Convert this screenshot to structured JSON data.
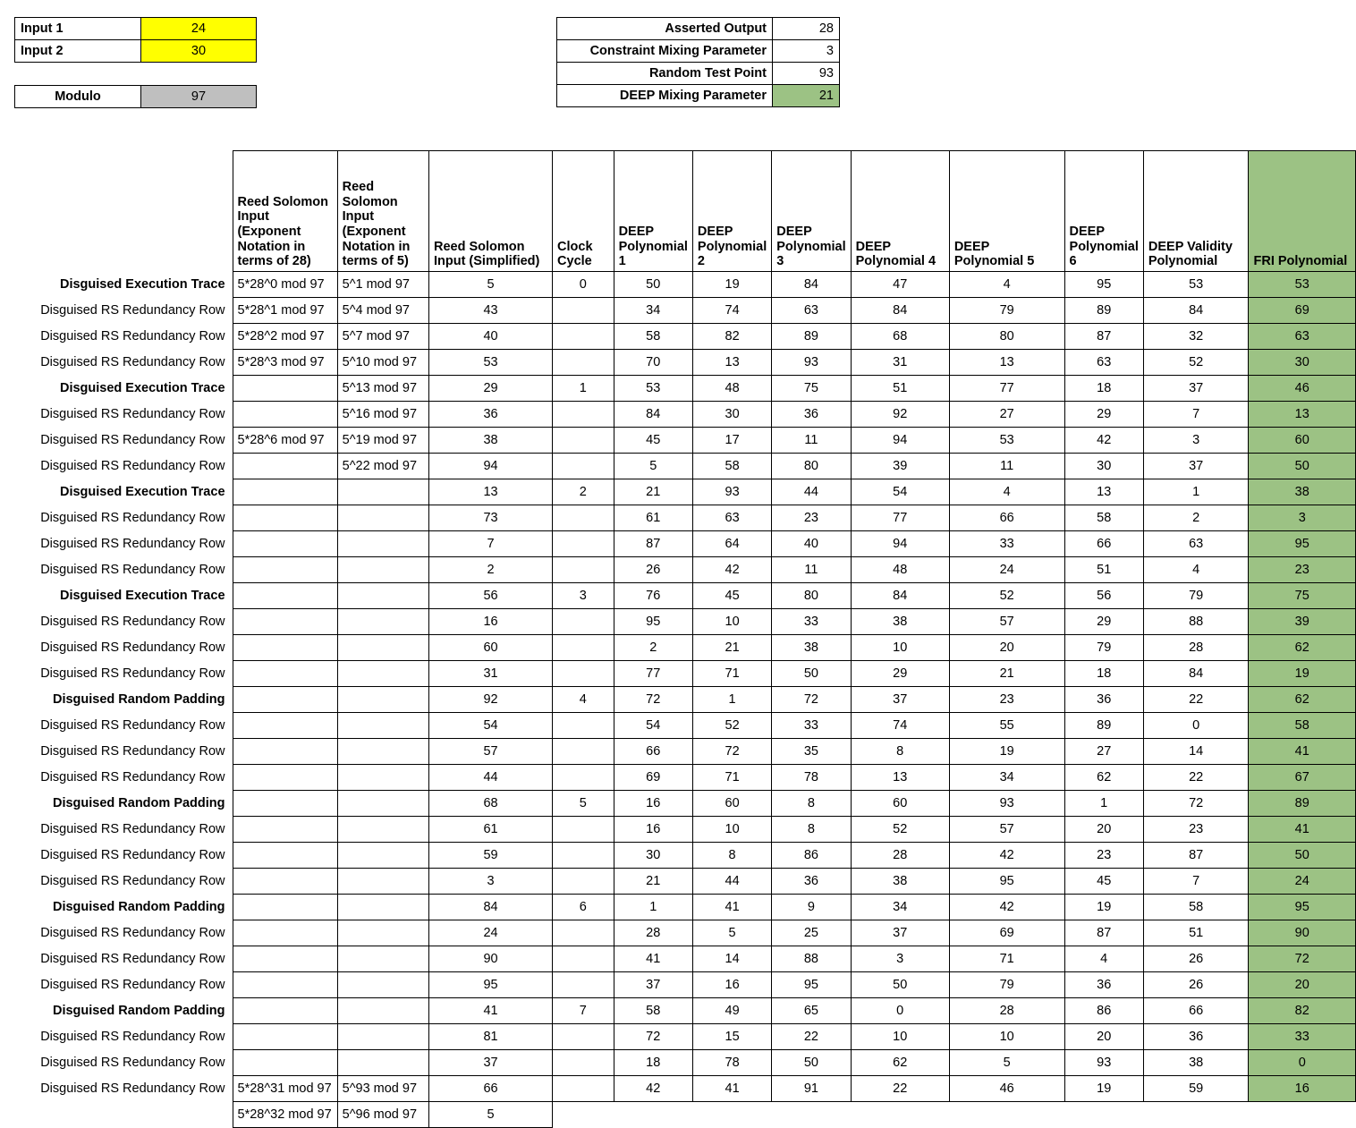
{
  "inputs_panel": {
    "rows": [
      {
        "label": "Input 1",
        "value": "24"
      },
      {
        "label": "Input 2",
        "value": "30"
      }
    ]
  },
  "modulo_panel": {
    "label": "Modulo",
    "value": "97"
  },
  "parameters_panel": {
    "rows": [
      {
        "label": "Asserted Output",
        "value": "28",
        "highlight": "none"
      },
      {
        "label": "Constraint Mixing Parameter",
        "value": "3",
        "highlight": "none"
      },
      {
        "label": "Random Test Point",
        "value": "93",
        "highlight": "none"
      },
      {
        "label": "DEEP Mixing Parameter",
        "value": "21",
        "highlight": "green"
      }
    ]
  },
  "colors": {
    "yellow_fill": "#ffff00",
    "gray_fill": "#bfbfbf",
    "green_fill": "#9cc284",
    "border": "#000000"
  },
  "main_table": {
    "headers": [
      "",
      "Reed Solomon Input (Exponent Notation in terms of 28)",
      "Reed Solomon Input (Exponent Notation in terms of 5)",
      "Reed Solomon Input (Simplified)",
      "Clock Cycle",
      "DEEP Polynomial 1",
      "DEEP Polynomial 2",
      "DEEP Polynomial 3",
      "DEEP Polynomial 4",
      "DEEP Polynomial 5",
      "DEEP Polynomial 6",
      "DEEP Validity Polynomial",
      "FRI Polynomial"
    ],
    "rows": [
      {
        "label": "Disguised Execution Trace",
        "bold": true,
        "rs28": "5*28^0 mod 97",
        "rs5": "5^1 mod 97",
        "simplified": "5",
        "clock": "0",
        "dp1": "50",
        "dp2": "19",
        "dp3": "84",
        "dp4": "47",
        "dp5": "4",
        "dp6": "95",
        "dvp": "53",
        "fri": "53"
      },
      {
        "label": "Disguised RS Redundancy Row",
        "bold": false,
        "rs28": "5*28^1 mod 97",
        "rs5": "5^4 mod 97",
        "simplified": "43",
        "clock": "",
        "dp1": "34",
        "dp2": "74",
        "dp3": "63",
        "dp4": "84",
        "dp5": "79",
        "dp6": "89",
        "dvp": "84",
        "fri": "69"
      },
      {
        "label": "Disguised RS Redundancy Row",
        "bold": false,
        "rs28": "5*28^2 mod 97",
        "rs5": "5^7 mod 97",
        "simplified": "40",
        "clock": "",
        "dp1": "58",
        "dp2": "82",
        "dp3": "89",
        "dp4": "68",
        "dp5": "80",
        "dp6": "87",
        "dvp": "32",
        "fri": "63"
      },
      {
        "label": "Disguised RS Redundancy Row",
        "bold": false,
        "rs28": "5*28^3 mod 97",
        "rs5": "5^10 mod 97",
        "simplified": "53",
        "clock": "",
        "dp1": "70",
        "dp2": "13",
        "dp3": "93",
        "dp4": "31",
        "dp5": "13",
        "dp6": "63",
        "dvp": "52",
        "fri": "30"
      },
      {
        "label": "Disguised Execution Trace",
        "bold": true,
        "rs28": "",
        "rs5": "5^13 mod 97",
        "simplified": "29",
        "clock": "1",
        "dp1": "53",
        "dp2": "48",
        "dp3": "75",
        "dp4": "51",
        "dp5": "77",
        "dp6": "18",
        "dvp": "37",
        "fri": "46"
      },
      {
        "label": "Disguised RS Redundancy Row",
        "bold": false,
        "rs28": "",
        "rs5": "5^16 mod 97",
        "simplified": "36",
        "clock": "",
        "dp1": "84",
        "dp2": "30",
        "dp3": "36",
        "dp4": "92",
        "dp5": "27",
        "dp6": "29",
        "dvp": "7",
        "fri": "13"
      },
      {
        "label": "Disguised RS Redundancy Row",
        "bold": false,
        "rs28": "5*28^6 mod 97",
        "rs5": "5^19 mod 97",
        "simplified": "38",
        "clock": "",
        "dp1": "45",
        "dp2": "17",
        "dp3": "11",
        "dp4": "94",
        "dp5": "53",
        "dp6": "42",
        "dvp": "3",
        "fri": "60"
      },
      {
        "label": "Disguised RS Redundancy Row",
        "bold": false,
        "rs28": "",
        "rs5": "5^22 mod 97",
        "simplified": "94",
        "clock": "",
        "dp1": "5",
        "dp2": "58",
        "dp3": "80",
        "dp4": "39",
        "dp5": "11",
        "dp6": "30",
        "dvp": "37",
        "fri": "50"
      },
      {
        "label": "Disguised Execution Trace",
        "bold": true,
        "rs28": "",
        "rs5": "",
        "simplified": "13",
        "clock": "2",
        "dp1": "21",
        "dp2": "93",
        "dp3": "44",
        "dp4": "54",
        "dp5": "4",
        "dp6": "13",
        "dvp": "1",
        "fri": "38"
      },
      {
        "label": "Disguised RS Redundancy Row",
        "bold": false,
        "rs28": "",
        "rs5": "",
        "simplified": "73",
        "clock": "",
        "dp1": "61",
        "dp2": "63",
        "dp3": "23",
        "dp4": "77",
        "dp5": "66",
        "dp6": "58",
        "dvp": "2",
        "fri": "3"
      },
      {
        "label": "Disguised RS Redundancy Row",
        "bold": false,
        "rs28": "",
        "rs5": "",
        "simplified": "7",
        "clock": "",
        "dp1": "87",
        "dp2": "64",
        "dp3": "40",
        "dp4": "94",
        "dp5": "33",
        "dp6": "66",
        "dvp": "63",
        "fri": "95"
      },
      {
        "label": "Disguised RS Redundancy Row",
        "bold": false,
        "rs28": "",
        "rs5": "",
        "simplified": "2",
        "clock": "",
        "dp1": "26",
        "dp2": "42",
        "dp3": "11",
        "dp4": "48",
        "dp5": "24",
        "dp6": "51",
        "dvp": "4",
        "fri": "23"
      },
      {
        "label": "Disguised Execution Trace",
        "bold": true,
        "rs28": "",
        "rs5": "",
        "simplified": "56",
        "clock": "3",
        "dp1": "76",
        "dp2": "45",
        "dp3": "80",
        "dp4": "84",
        "dp5": "52",
        "dp6": "56",
        "dvp": "79",
        "fri": "75"
      },
      {
        "label": "Disguised RS Redundancy Row",
        "bold": false,
        "rs28": "",
        "rs5": "",
        "simplified": "16",
        "clock": "",
        "dp1": "95",
        "dp2": "10",
        "dp3": "33",
        "dp4": "38",
        "dp5": "57",
        "dp6": "29",
        "dvp": "88",
        "fri": "39"
      },
      {
        "label": "Disguised RS Redundancy Row",
        "bold": false,
        "rs28": "",
        "rs5": "",
        "simplified": "60",
        "clock": "",
        "dp1": "2",
        "dp2": "21",
        "dp3": "38",
        "dp4": "10",
        "dp5": "20",
        "dp6": "79",
        "dvp": "28",
        "fri": "62"
      },
      {
        "label": "Disguised RS Redundancy Row",
        "bold": false,
        "rs28": "",
        "rs5": "",
        "simplified": "31",
        "clock": "",
        "dp1": "77",
        "dp2": "71",
        "dp3": "50",
        "dp4": "29",
        "dp5": "21",
        "dp6": "18",
        "dvp": "84",
        "fri": "19"
      },
      {
        "label": "Disguised Random Padding",
        "bold": true,
        "rs28": "",
        "rs5": "",
        "simplified": "92",
        "clock": "4",
        "dp1": "72",
        "dp2": "1",
        "dp3": "72",
        "dp4": "37",
        "dp5": "23",
        "dp6": "36",
        "dvp": "22",
        "fri": "62"
      },
      {
        "label": "Disguised RS Redundancy Row",
        "bold": false,
        "rs28": "",
        "rs5": "",
        "simplified": "54",
        "clock": "",
        "dp1": "54",
        "dp2": "52",
        "dp3": "33",
        "dp4": "74",
        "dp5": "55",
        "dp6": "89",
        "dvp": "0",
        "fri": "58"
      },
      {
        "label": "Disguised RS Redundancy Row",
        "bold": false,
        "rs28": "",
        "rs5": "",
        "simplified": "57",
        "clock": "",
        "dp1": "66",
        "dp2": "72",
        "dp3": "35",
        "dp4": "8",
        "dp5": "19",
        "dp6": "27",
        "dvp": "14",
        "fri": "41"
      },
      {
        "label": "Disguised RS Redundancy Row",
        "bold": false,
        "rs28": "",
        "rs5": "",
        "simplified": "44",
        "clock": "",
        "dp1": "69",
        "dp2": "71",
        "dp3": "78",
        "dp4": "13",
        "dp5": "34",
        "dp6": "62",
        "dvp": "22",
        "fri": "67"
      },
      {
        "label": "Disguised Random Padding",
        "bold": true,
        "rs28": "",
        "rs5": "",
        "simplified": "68",
        "clock": "5",
        "dp1": "16",
        "dp2": "60",
        "dp3": "8",
        "dp4": "60",
        "dp5": "93",
        "dp6": "1",
        "dvp": "72",
        "fri": "89"
      },
      {
        "label": "Disguised RS Redundancy Row",
        "bold": false,
        "rs28": "",
        "rs5": "",
        "simplified": "61",
        "clock": "",
        "dp1": "16",
        "dp2": "10",
        "dp3": "8",
        "dp4": "52",
        "dp5": "57",
        "dp6": "20",
        "dvp": "23",
        "fri": "41"
      },
      {
        "label": "Disguised RS Redundancy Row",
        "bold": false,
        "rs28": "",
        "rs5": "",
        "simplified": "59",
        "clock": "",
        "dp1": "30",
        "dp2": "8",
        "dp3": "86",
        "dp4": "28",
        "dp5": "42",
        "dp6": "23",
        "dvp": "87",
        "fri": "50"
      },
      {
        "label": "Disguised RS Redundancy Row",
        "bold": false,
        "rs28": "",
        "rs5": "",
        "simplified": "3",
        "clock": "",
        "dp1": "21",
        "dp2": "44",
        "dp3": "36",
        "dp4": "38",
        "dp5": "95",
        "dp6": "45",
        "dvp": "7",
        "fri": "24"
      },
      {
        "label": "Disguised Random Padding",
        "bold": true,
        "rs28": "",
        "rs5": "",
        "simplified": "84",
        "clock": "6",
        "dp1": "1",
        "dp2": "41",
        "dp3": "9",
        "dp4": "34",
        "dp5": "42",
        "dp6": "19",
        "dvp": "58",
        "fri": "95"
      },
      {
        "label": "Disguised RS Redundancy Row",
        "bold": false,
        "rs28": "",
        "rs5": "",
        "simplified": "24",
        "clock": "",
        "dp1": "28",
        "dp2": "5",
        "dp3": "25",
        "dp4": "37",
        "dp5": "69",
        "dp6": "87",
        "dvp": "51",
        "fri": "90"
      },
      {
        "label": "Disguised RS Redundancy Row",
        "bold": false,
        "rs28": "",
        "rs5": "",
        "simplified": "90",
        "clock": "",
        "dp1": "41",
        "dp2": "14",
        "dp3": "88",
        "dp4": "3",
        "dp5": "71",
        "dp6": "4",
        "dvp": "26",
        "fri": "72"
      },
      {
        "label": "Disguised RS Redundancy Row",
        "bold": false,
        "rs28": "",
        "rs5": "",
        "simplified": "95",
        "clock": "",
        "dp1": "37",
        "dp2": "16",
        "dp3": "95",
        "dp4": "50",
        "dp5": "79",
        "dp6": "36",
        "dvp": "26",
        "fri": "20"
      },
      {
        "label": "Disguised Random Padding",
        "bold": true,
        "rs28": "",
        "rs5": "",
        "simplified": "41",
        "clock": "7",
        "dp1": "58",
        "dp2": "49",
        "dp3": "65",
        "dp4": "0",
        "dp5": "28",
        "dp6": "86",
        "dvp": "66",
        "fri": "82"
      },
      {
        "label": "Disguised RS Redundancy Row",
        "bold": false,
        "rs28": "",
        "rs5": "",
        "simplified": "81",
        "clock": "",
        "dp1": "72",
        "dp2": "15",
        "dp3": "22",
        "dp4": "10",
        "dp5": "10",
        "dp6": "20",
        "dvp": "36",
        "fri": "33"
      },
      {
        "label": "Disguised RS Redundancy Row",
        "bold": false,
        "rs28": "",
        "rs5": "",
        "simplified": "37",
        "clock": "",
        "dp1": "18",
        "dp2": "78",
        "dp3": "50",
        "dp4": "62",
        "dp5": "5",
        "dp6": "93",
        "dvp": "38",
        "fri": "0"
      },
      {
        "label": "Disguised RS Redundancy Row",
        "bold": false,
        "rs28": "5*28^31 mod 97",
        "rs5": "5^93 mod 97",
        "simplified": "66",
        "clock": "",
        "dp1": "42",
        "dp2": "41",
        "dp3": "91",
        "dp4": "22",
        "dp5": "46",
        "dp6": "19",
        "dvp": "59",
        "fri": "16"
      },
      {
        "label": "",
        "bold": false,
        "rs28": "5*28^32 mod 97",
        "rs5": "5^96 mod 97",
        "simplified": "5",
        "clock": null,
        "dp1": null,
        "dp2": null,
        "dp3": null,
        "dp4": null,
        "dp5": null,
        "dp6": null,
        "dvp": null,
        "fri": null
      }
    ]
  }
}
